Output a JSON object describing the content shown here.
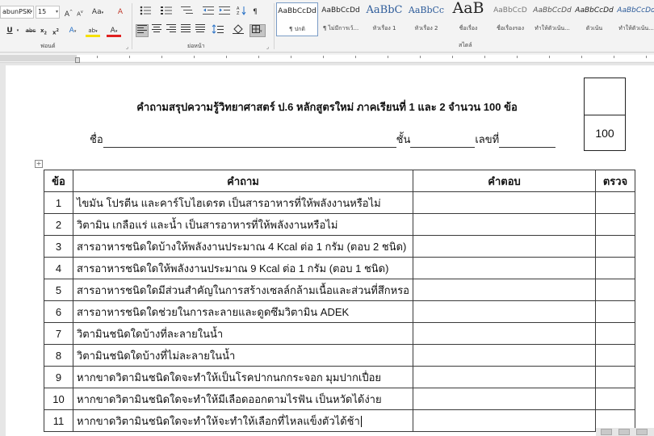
{
  "ribbon": {
    "font": {
      "name": "abunPSK",
      "size": "15",
      "grow_glyph": "A",
      "shrink_glyph": "A",
      "case_label": "Aa",
      "clear_glyph": "A",
      "underline_glyph": "U",
      "strike_glyph": "abc",
      "sub_glyph": "x",
      "sup_glyph": "x",
      "effects_glyph": "A",
      "highlight_glyph": "ab",
      "color_glyph": "A",
      "group_label": "ฟอนต์"
    },
    "paragraph": {
      "group_label": "ย่อหน้า",
      "show_marks_glyph": "¶"
    },
    "styles": {
      "group_label": "สไตล์",
      "items": [
        {
          "sample": "AaBbCcDd",
          "name": "¶ ปกติ"
        },
        {
          "sample": "AaBbCcDd",
          "name": "¶ ไม่มีการเว้..."
        },
        {
          "sample": "AaBbC",
          "name": "หัวเรื่อง 1"
        },
        {
          "sample": "AaBbCc",
          "name": "หัวเรื่อง 2"
        },
        {
          "sample": "AaB",
          "name": "ชื่อเรื่อง"
        },
        {
          "sample": "AaBbCcD",
          "name": "ชื่อเรื่องรอง"
        },
        {
          "sample": "AaBbCcDd",
          "name": "ทำให้ตัวเน้น..."
        },
        {
          "sample": "AaBbCcDd",
          "name": "ตัวเน้น"
        },
        {
          "sample": "AaBbCcDd",
          "name": "ทำให้ตัวเน้น..."
        }
      ]
    }
  },
  "document": {
    "title": "คำถามสรุปความรู้วิทยาศาสตร์ ป.6 หลักสูตรใหม่ ภาคเรียนที่ 1 และ 2 จำนวน 100 ข้อ",
    "name_label": "ชื่อ",
    "class_label": "ชั้น",
    "number_label": "เลขที่",
    "score_total": "100",
    "table": {
      "headers": [
        "ข้อ",
        "คำถาม",
        "คำตอบ",
        "ตรวจ"
      ],
      "rows": [
        {
          "num": "1",
          "question": "ไขมัน โปรตีน และคาร์โบไฮเดรต เป็นสารอาหารที่ให้พลังงานหรือไม่"
        },
        {
          "num": "2",
          "question": "วิตามิน เกลือแร่ และน้ำ เป็นสารอาหารที่ให้พลังงานหรือไม่"
        },
        {
          "num": "3",
          "question": "สารอาหารชนิดใดบ้างให้พลังงานประมาณ 4 Kcal ต่อ 1 กรัม (ตอบ 2 ชนิด)"
        },
        {
          "num": "4",
          "question": "สารอาหารชนิดใดให้พลังงานประมาณ 9 Kcal ต่อ 1 กรัม (ตอบ 1 ชนิด)"
        },
        {
          "num": "5",
          "question": "สารอาหารชนิดใดมีส่วนสำคัญในการสร้างเซลล์กล้ามเนื้อและส่วนที่สึกหรอ"
        },
        {
          "num": "6",
          "question": "สารอาหารชนิดใดช่วยในการละลายและดูดซึมวิตามิน ADEK"
        },
        {
          "num": "7",
          "question": "วิตามินชนิดใดบ้างที่ละลายในน้ำ"
        },
        {
          "num": "8",
          "question": "วิตามินชนิดใดบ้างที่ไม่ละลายในน้ำ"
        },
        {
          "num": "9",
          "question": "หากขาดวิตามินชนิดใดจะทำให้เป็นโรคปากนกกระจอก มุมปากเปื่อย"
        },
        {
          "num": "10",
          "question": "หากขาดวิตามินชนิดใดจะทำให้มีเลือดออกตามไรฟัน เป็นหวัดได้ง่าย"
        },
        {
          "num": "11",
          "question": "หากขาดวิตามินชนิดใดจะทำให้จะทำให้เลือกที่ไหลแข็งตัวได้ช้า"
        }
      ]
    }
  }
}
